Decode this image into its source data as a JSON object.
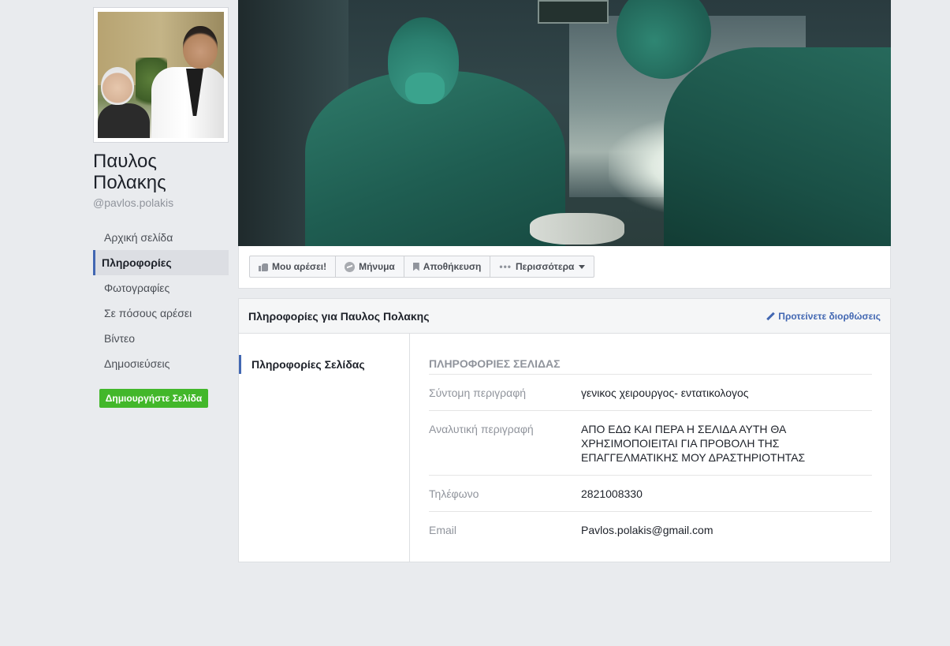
{
  "page": {
    "name": "Παυλος Πολακης",
    "handle": "@pavlos.polakis"
  },
  "left_nav": {
    "items": [
      {
        "label": "Αρχική σελίδα"
      },
      {
        "label": "Πληροφορίες"
      },
      {
        "label": "Φωτογραφίες"
      },
      {
        "label": "Σε πόσους αρέσει"
      },
      {
        "label": "Βίντεο"
      },
      {
        "label": "Δημοσιεύσεις"
      }
    ],
    "active_index": 1,
    "create_page_label": "Δημιουργήστε Σελίδα"
  },
  "actions": {
    "like": "Μου αρέσει!",
    "message": "Μήνυμα",
    "save": "Αποθήκευση",
    "more": "Περισσότερα"
  },
  "about": {
    "title": "Πληροφορίες για Παυλος Πολακης",
    "suggest_edits": "Προτείνετε διορθώσεις",
    "side_item": "Πληροφορίες Σελίδας",
    "section_title": "ΠΛΗΡΟΦΟΡΙΕΣ ΣΕΛΙΔΑΣ",
    "rows": [
      {
        "label": "Σύντομη περιγραφή",
        "value": "γενικος χειρουργος- εντατικολογος"
      },
      {
        "label": "Αναλυτική περιγραφή",
        "value": "ΑΠΟ ΕΔΩ ΚΑΙ ΠΕΡΑ Η ΣΕΛΙΔΑ ΑΥΤΗ ΘΑ ΧΡΗΣΙΜΟΠΟΙΕΙΤΑΙ ΓΙΑ ΠΡΟΒΟΛΗ ΤΗΣ ΕΠΑΓΓΕΛΜΑΤΙΚΗΣ ΜΟΥ ΔΡΑΣΤΗΡΙΟΤΗΤΑΣ"
      },
      {
        "label": "Τηλέφωνο",
        "value": "2821008330"
      },
      {
        "label": "Email",
        "value": "Pavlos.polakis@gmail.com"
      }
    ]
  },
  "colors": {
    "background": "#e9ebee",
    "accent": "#4267b2",
    "create_button": "#42b72a"
  },
  "icons": {
    "like": "thumbs-up-icon",
    "message": "messenger-icon",
    "save": "bookmark-icon",
    "more": "dots-icon",
    "suggest": "pencil-icon"
  }
}
